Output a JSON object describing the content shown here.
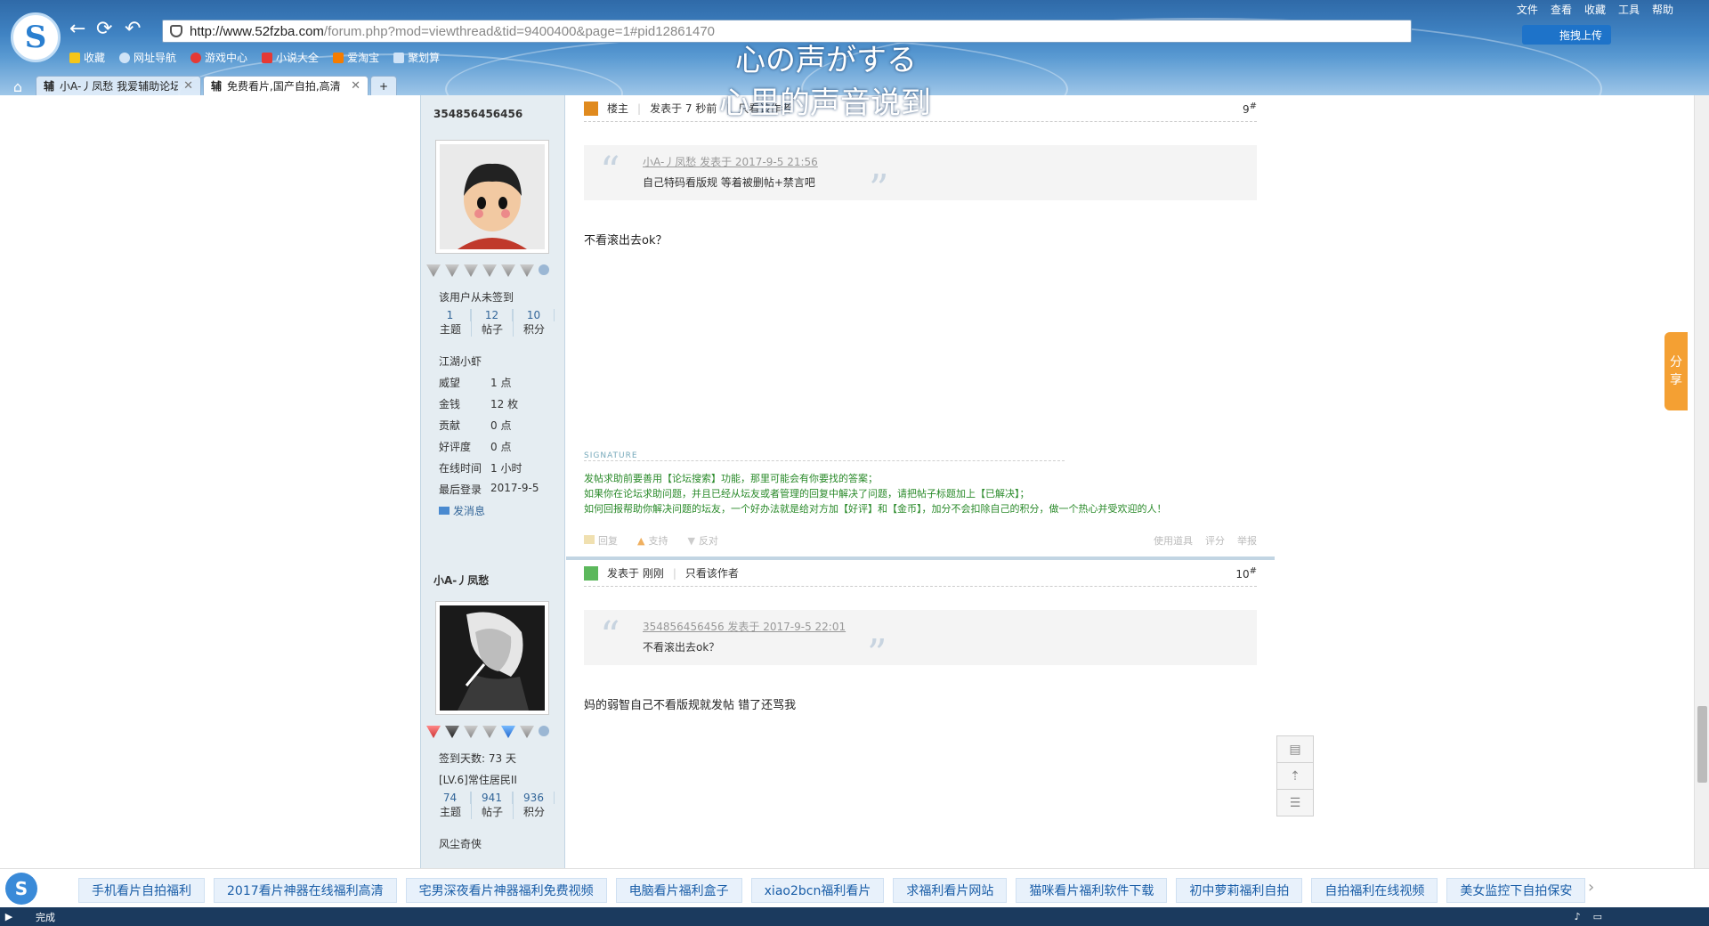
{
  "browser": {
    "url_host": "http://www.52fzba.com",
    "url_path": "/forum.php?mod=viewthread&tid=9400400&page=1#pid12861470",
    "menu": [
      "文件",
      "查看",
      "收藏",
      "工具",
      "帮助"
    ],
    "bookmarks": [
      {
        "label": "收藏",
        "color": "#f5c518"
      },
      {
        "label": "网址导航",
        "color": "#cfe3f7"
      },
      {
        "label": "游戏中心",
        "color": "#e53935"
      },
      {
        "label": "小说大全",
        "color": "#e53935"
      },
      {
        "label": "爱淘宝",
        "color": "#f57c00"
      },
      {
        "label": "聚划算",
        "color": "#cfe3f7"
      }
    ],
    "skin_text_1": "心の声がする",
    "skin_text_2": "心里的声音说到",
    "upload_label": "拖拽上传",
    "tabs": [
      {
        "icon": "辅",
        "label": "小A-丿凤愁 我爱辅助论坛"
      },
      {
        "icon": "辅",
        "label": "免费看片,国产自拍,高清"
      }
    ],
    "status_text": "完成"
  },
  "posts": [
    {
      "author": "354856456456",
      "sign_status": "该用户从未签到",
      "stats": [
        {
          "n": "1",
          "l": "主题"
        },
        {
          "n": "12",
          "l": "帖子"
        },
        {
          "n": "10",
          "l": "积分"
        }
      ],
      "level": "江湖小虾",
      "fields": [
        {
          "k": "威望",
          "v": "1 点"
        },
        {
          "k": "金钱",
          "v": "12 枚"
        },
        {
          "k": "贡献",
          "v": "0 点"
        },
        {
          "k": "好评度",
          "v": "0 点"
        },
        {
          "k": "在线时间",
          "v": "1 小时"
        },
        {
          "k": "最后登录",
          "v": "2017-9-5"
        }
      ],
      "pm": "发消息",
      "op_badge": "楼主",
      "posted": "发表于 7 秒前",
      "author_only": "只看该作者",
      "floor": "9",
      "quote_by": "小A-丿凤愁 发表于 2017-9-5 21:56",
      "quote_text": "自己特码看版规 等着被删帖+禁言吧",
      "message": "不看滚出去ok？",
      "signature_title": "SIGNATURE",
      "signature_lines": [
        "发帖求助前要善用【论坛搜索】功能，那里可能会有你要找的答案；",
        "如果你在论坛求助问题，并且已经从坛友或者管理的回复中解决了问题，请把帖子标题加上【已解决】；",
        "如何回报帮助你解决问题的坛友，一个好办法就是给对方加【好评】和【金币】，加分不会扣除自己的积分，做一个热心并受欢迎的人！"
      ],
      "actions_left": [
        "回复",
        "支持",
        "反对"
      ],
      "actions_right": [
        "使用道具",
        "评分",
        "举报"
      ]
    },
    {
      "author": "小A-丿凤愁",
      "sign_days": "签到天数: 73 天",
      "rank": "[LV.6]常住居民II",
      "stats": [
        {
          "n": "74",
          "l": "主题"
        },
        {
          "n": "941",
          "l": "帖子"
        },
        {
          "n": "936",
          "l": "积分"
        }
      ],
      "level": "风尘奇侠",
      "posted": "发表于 刚刚",
      "author_only": "只看该作者",
      "floor": "10",
      "quote_by": "354856456456 发表于 2017-9-5 22:01",
      "quote_text": "不看滚出去ok？",
      "message": "妈的弱智自己不看版规就发帖 错了还骂我"
    }
  ],
  "share_tab": "分享",
  "bottom_links": [
    "手机看片自拍福利",
    "2017看片神器在线福利高清",
    "宅男深夜看片神器福利免费视频",
    "电脑看片福利盒子",
    "xiao2bcn福利看片",
    "求福利看片网站",
    "猫咪看片福利软件下载",
    "初中萝莉福利自拍",
    "自拍福利在线视频",
    "美女监控下自拍保安"
  ]
}
